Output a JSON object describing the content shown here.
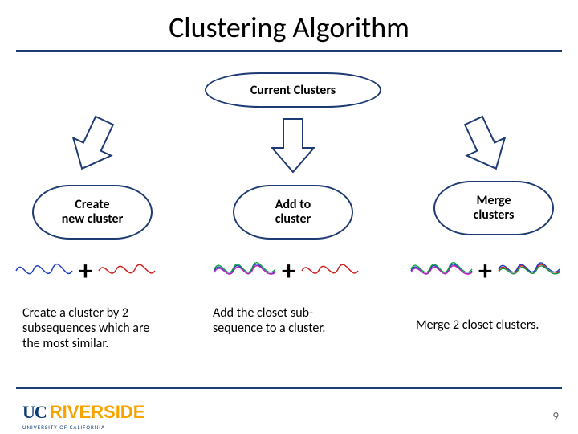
{
  "title": "Clustering Algorithm",
  "top_pill": "Current Clusters",
  "options": {
    "left": {
      "l1": "Create",
      "l2": "new cluster"
    },
    "mid": {
      "l1": "Add to",
      "l2": "cluster"
    },
    "right": {
      "l1": "Merge",
      "l2": "clusters"
    }
  },
  "plus": "+",
  "descriptions": {
    "left": "Create a cluster by 2 subsequences which are the most similar.",
    "mid": "Add the closet sub-sequence to a cluster.",
    "right": "Merge 2 closet clusters."
  },
  "logo": {
    "uc": "UC",
    "riv": "RIVERSIDE",
    "sub": "UNIVERSITY OF CALIFORNIA"
  },
  "page": "9",
  "colors": {
    "accent": "#1f3b73",
    "wave_blue": "#2040c0",
    "wave_red": "#d02020",
    "wave_green": "#10a040",
    "wave_magenta": "#c020c0"
  }
}
